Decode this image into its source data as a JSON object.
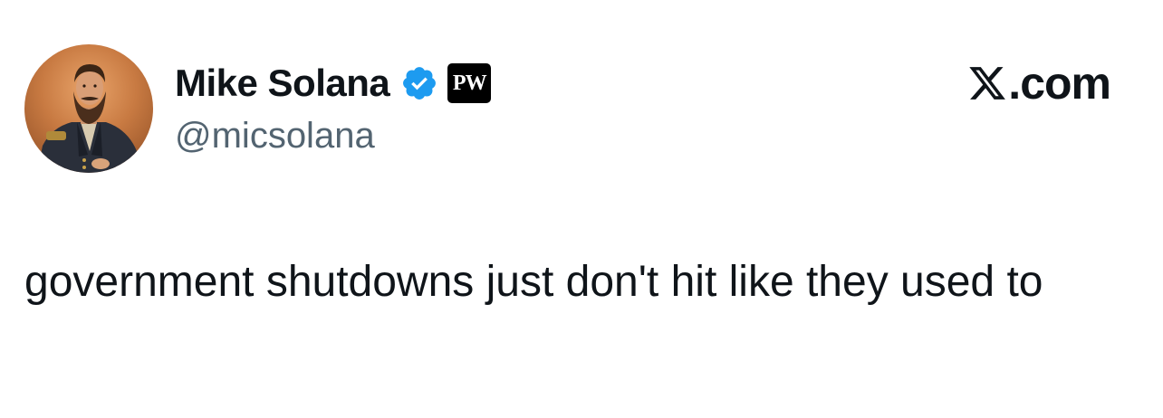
{
  "author": {
    "display_name": "Mike Solana",
    "handle": "@micsolana",
    "verified": true,
    "affiliation_badge": "PW"
  },
  "brand": {
    "site_label": ".com",
    "icon": "x-logo-icon"
  },
  "tweet": {
    "text": "government shutdowns just don't hit like they used to"
  },
  "colors": {
    "verified_blue": "#1d9bf0",
    "text": "#0f1419",
    "muted": "#536471",
    "background": "#ffffff"
  }
}
